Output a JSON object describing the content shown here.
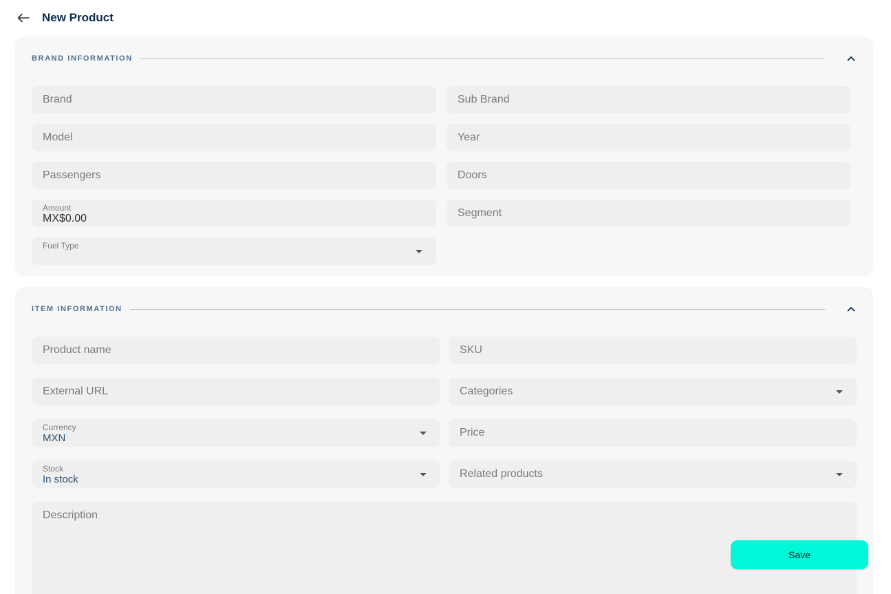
{
  "header": {
    "title": "New Product",
    "back_icon": "arrow-left-icon"
  },
  "brand_section": {
    "title": "BRAND INFORMATION",
    "collapse_icon": "chevron-up-icon",
    "fields": {
      "brand": {
        "placeholder": "Brand"
      },
      "sub_brand": {
        "placeholder": "Sub Brand"
      },
      "model": {
        "placeholder": "Model"
      },
      "year": {
        "placeholder": "Year"
      },
      "passengers": {
        "placeholder": "Passengers"
      },
      "doors": {
        "placeholder": "Doors"
      },
      "amount": {
        "label": "Amount",
        "value": "MX$0.00"
      },
      "segment": {
        "placeholder": "Segment"
      },
      "fuel_type": {
        "label": "Fuel Type",
        "value": ""
      }
    }
  },
  "item_section": {
    "title": "ITEM INFORMATION",
    "collapse_icon": "chevron-up-icon",
    "fields": {
      "product_name": {
        "placeholder": "Product name"
      },
      "sku": {
        "placeholder": "SKU"
      },
      "external_url": {
        "placeholder": "External URL"
      },
      "categories": {
        "placeholder": "Categories"
      },
      "currency": {
        "label": "Currency",
        "value": "MXN"
      },
      "price": {
        "placeholder": "Price"
      },
      "stock": {
        "label": "Stock",
        "value": "In stock"
      },
      "related_products": {
        "placeholder": "Related products"
      },
      "description": {
        "placeholder": "Description"
      }
    }
  },
  "actions": {
    "save_label": "Save"
  },
  "colors": {
    "accent": "#00f8d8",
    "title": "#0d2b4e",
    "section_title": "#4f6f8f",
    "card_bg": "#f7f7f7",
    "field_bg": "#efefef"
  }
}
